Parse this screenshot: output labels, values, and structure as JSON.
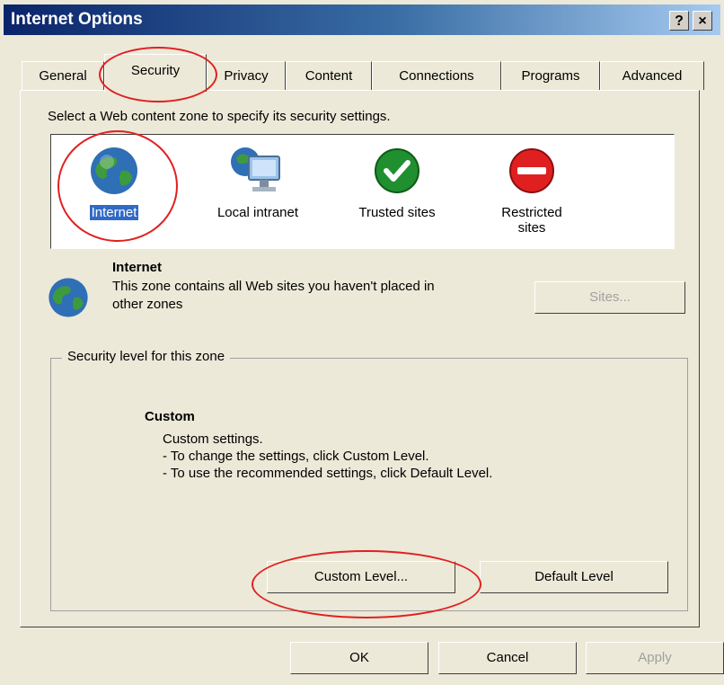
{
  "window": {
    "title": "Internet Options",
    "help_button": "?",
    "close_button": "×"
  },
  "tabs": [
    {
      "label": "General"
    },
    {
      "label": "Security"
    },
    {
      "label": "Privacy"
    },
    {
      "label": "Content"
    },
    {
      "label": "Connections"
    },
    {
      "label": "Programs"
    },
    {
      "label": "Advanced"
    }
  ],
  "security": {
    "prompt": "Select a Web content zone to specify its security settings.",
    "zones": [
      {
        "label": "Internet",
        "icon": "globe-icon"
      },
      {
        "label": "Local intranet",
        "icon": "intranet-icon"
      },
      {
        "label": "Trusted sites",
        "icon": "check-icon"
      },
      {
        "label": "Restricted sites",
        "icon": "restricted-icon"
      }
    ],
    "selected_zone": {
      "name": "Internet",
      "description": "This zone contains all Web sites you haven't placed in other zones",
      "sites_button": "Sites..."
    },
    "level_group": {
      "legend": "Security level for this zone",
      "level_name": "Custom",
      "line1": "Custom settings.",
      "line2": "- To change the settings, click Custom Level.",
      "line3": "- To use the recommended settings, click Default Level.",
      "custom_button": "Custom Level...",
      "default_button": "Default Level"
    }
  },
  "footer": {
    "ok": "OK",
    "cancel": "Cancel",
    "apply": "Apply"
  },
  "colors": {
    "titlebar": "#0a246a",
    "dialog": "#ece9d8",
    "selection": "#316ac5",
    "annotation": "#e02020"
  }
}
